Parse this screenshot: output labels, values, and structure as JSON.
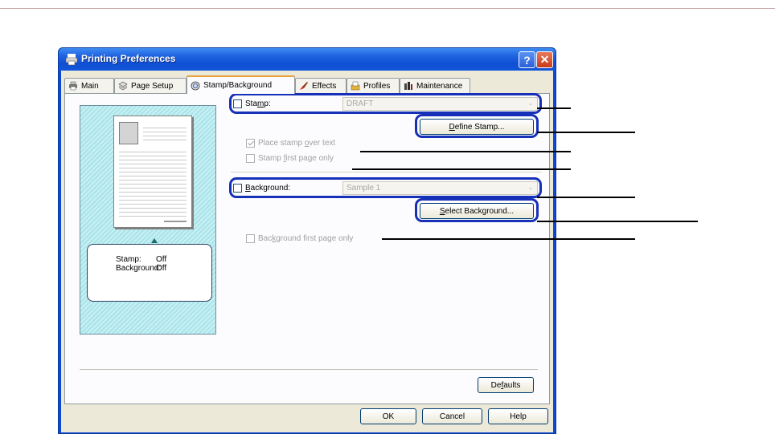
{
  "window": {
    "title": "Printing Preferences",
    "help_glyph": "?",
    "close_glyph": "✕"
  },
  "tabs": [
    {
      "label": "Main",
      "icon": "printer-icon"
    },
    {
      "label": "Page Setup",
      "icon": "pages-icon"
    },
    {
      "label": "Stamp/Background",
      "icon": "stamp-icon",
      "active": true
    },
    {
      "label": "Effects",
      "icon": "brush-icon"
    },
    {
      "label": "Profiles",
      "icon": "profiles-icon"
    },
    {
      "label": "Maintenance",
      "icon": "tools-icon"
    }
  ],
  "preview": {
    "stamp_label": "Stamp:",
    "stamp_value": "Off",
    "background_label": "Background:",
    "background_value": "Off"
  },
  "stamp": {
    "checkbox_label_pre": "Sta",
    "checkbox_label_mnemonic": "m",
    "checkbox_label_post": "p:",
    "checked": false,
    "select_value": "DRAFT",
    "define_pre": "",
    "define_mnemonic": "D",
    "define_post": "efine Stamp...",
    "over_text_pre": "Place stamp ",
    "over_text_mnemonic": "o",
    "over_text_post": "ver text",
    "over_text_checked": true,
    "first_page_pre": "Stamp ",
    "first_page_mnemonic": "f",
    "first_page_post": "irst page only",
    "first_page_checked": false
  },
  "background": {
    "checkbox_label_pre": "",
    "checkbox_label_mnemonic": "B",
    "checkbox_label_post": "ackground:",
    "checked": false,
    "select_value": "Sample 1",
    "select_pre": "",
    "select_mnemonic": "S",
    "select_post": "elect Background...",
    "first_page_pre": "Bac",
    "first_page_mnemonic": "k",
    "first_page_post": "ground first page only",
    "first_page_checked": false
  },
  "buttons": {
    "defaults_pre": "De",
    "defaults_mnemonic": "f",
    "defaults_post": "aults",
    "ok": "OK",
    "cancel": "Cancel",
    "help": "Help"
  },
  "colors": {
    "highlight": "#1630b8",
    "titlebar": "#1f63e0",
    "active_tab_accent": "#e6a23c"
  }
}
